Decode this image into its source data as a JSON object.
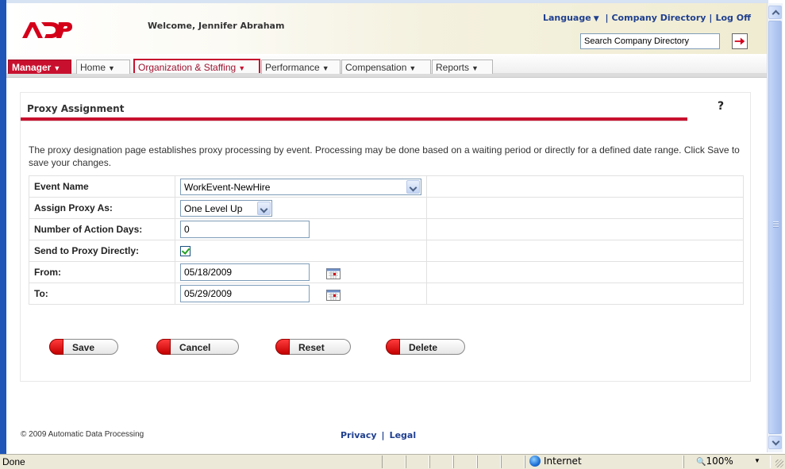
{
  "header": {
    "welcome": "Welcome, Jennifer Abraham",
    "language_label": "Language",
    "company_directory_label": "Company Directory",
    "log_off_label": "Log Off",
    "search_placeholder": "Search Company Directory",
    "search_value": "Search Company Directory",
    "logo_icon": "adp-logo",
    "go_icon": "arrow-right-icon"
  },
  "menu": {
    "items": [
      {
        "label": "Manager"
      },
      {
        "label": "Home"
      },
      {
        "label": "Organization & Staffing",
        "active": true
      },
      {
        "label": "Performance"
      },
      {
        "label": "Compensation"
      },
      {
        "label": "Reports"
      }
    ]
  },
  "page": {
    "title": "Proxy Assignment",
    "help_label": "?",
    "intro": "The proxy designation page establishes proxy processing by event.  Processing may be done based on a waiting  period or directly for a defined date range.  Click Save to save your changes."
  },
  "form": {
    "event_name_label": "Event Name",
    "event_name_value": "WorkEvent-NewHire",
    "assign_proxy_label": "Assign Proxy As:",
    "assign_proxy_value": "One Level Up",
    "action_days_label": "Number of Action Days:",
    "action_days_value": "0",
    "send_directly_label": "Send to Proxy Directly:",
    "send_directly_checked": true,
    "from_label": "From:",
    "from_value": "05/18/2009",
    "to_label": "To:",
    "to_value": "05/29/2009"
  },
  "buttons": {
    "save": "Save",
    "cancel": "Cancel",
    "reset": "Reset",
    "delete": "Delete"
  },
  "footer": {
    "copyright": "© 2009 Automatic Data Processing",
    "privacy": "Privacy",
    "legal": "Legal"
  },
  "statusbar": {
    "status": "Done",
    "zone": "Internet",
    "zoom": "100%"
  },
  "colors": {
    "brand_red": "#c8102e",
    "link_blue": "#1f3f8f",
    "window_blue": "#1f56b8"
  }
}
